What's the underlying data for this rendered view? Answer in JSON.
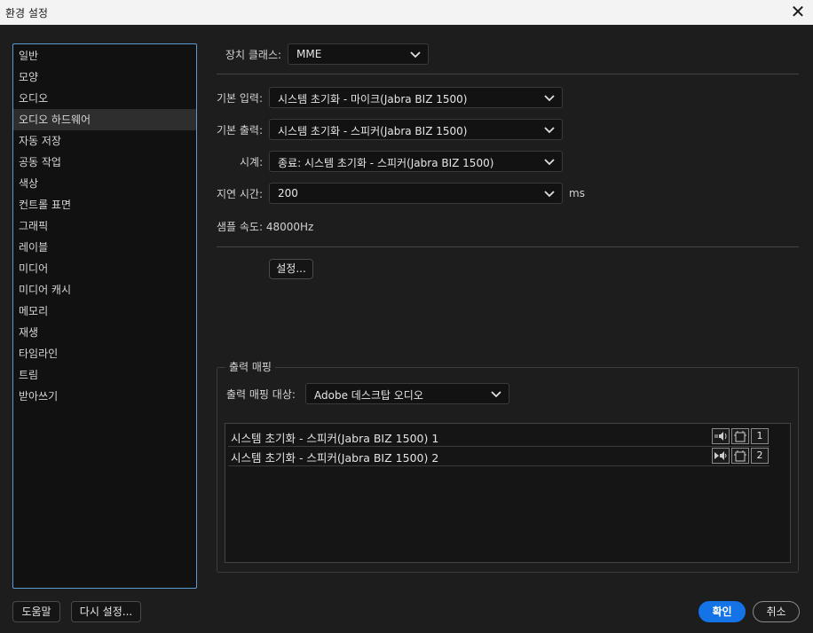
{
  "window": {
    "title": "환경 설정"
  },
  "sidebar": {
    "items": [
      {
        "label": "일반"
      },
      {
        "label": "모양"
      },
      {
        "label": "오디오"
      },
      {
        "label": "오디오 하드웨어",
        "selected": true
      },
      {
        "label": "자동 저장"
      },
      {
        "label": "공동 작업"
      },
      {
        "label": "색상"
      },
      {
        "label": "컨트롤 표면"
      },
      {
        "label": "그래픽"
      },
      {
        "label": "레이블"
      },
      {
        "label": "미디어"
      },
      {
        "label": "미디어 캐시"
      },
      {
        "label": "메모리"
      },
      {
        "label": "재생"
      },
      {
        "label": "타임라인"
      },
      {
        "label": "트림"
      },
      {
        "label": "받아쓰기"
      }
    ]
  },
  "hardware": {
    "device_class_label": "장치 클래스:",
    "device_class_value": "MME",
    "default_input_label": "기본 입력:",
    "default_input_value": "시스템 초기화 - 마이크(Jabra BIZ 1500)",
    "default_output_label": "기본 출력:",
    "default_output_value": "시스템 초기화 - 스피커(Jabra BIZ 1500)",
    "clock_label": "시계:",
    "clock_value": "종료: 시스템 초기화 - 스피커(Jabra BIZ 1500)",
    "latency_label": "지연 시간:",
    "latency_value": "200",
    "latency_unit": "ms",
    "sample_rate_text": "샘플 속도: 48000Hz",
    "settings_button": "설정..."
  },
  "output_mapping": {
    "group_label": "출력 매핑",
    "target_label": "출력 매핑 대상:",
    "target_value": "Adobe 데스크탑 오디오",
    "rows": [
      {
        "label": "시스템 초기화 - 스피커(Jabra BIZ 1500) 1",
        "channel": "1"
      },
      {
        "label": "시스템 초기화 - 스피커(Jabra BIZ 1500) 2",
        "channel": "2"
      }
    ]
  },
  "footer": {
    "help": "도움말",
    "reset": "다시 설정...",
    "ok": "확인",
    "cancel": "취소"
  },
  "colors": {
    "accent": "#1473e6",
    "sidebar_border": "#5b9bd5",
    "background": "#1d1d1d"
  }
}
